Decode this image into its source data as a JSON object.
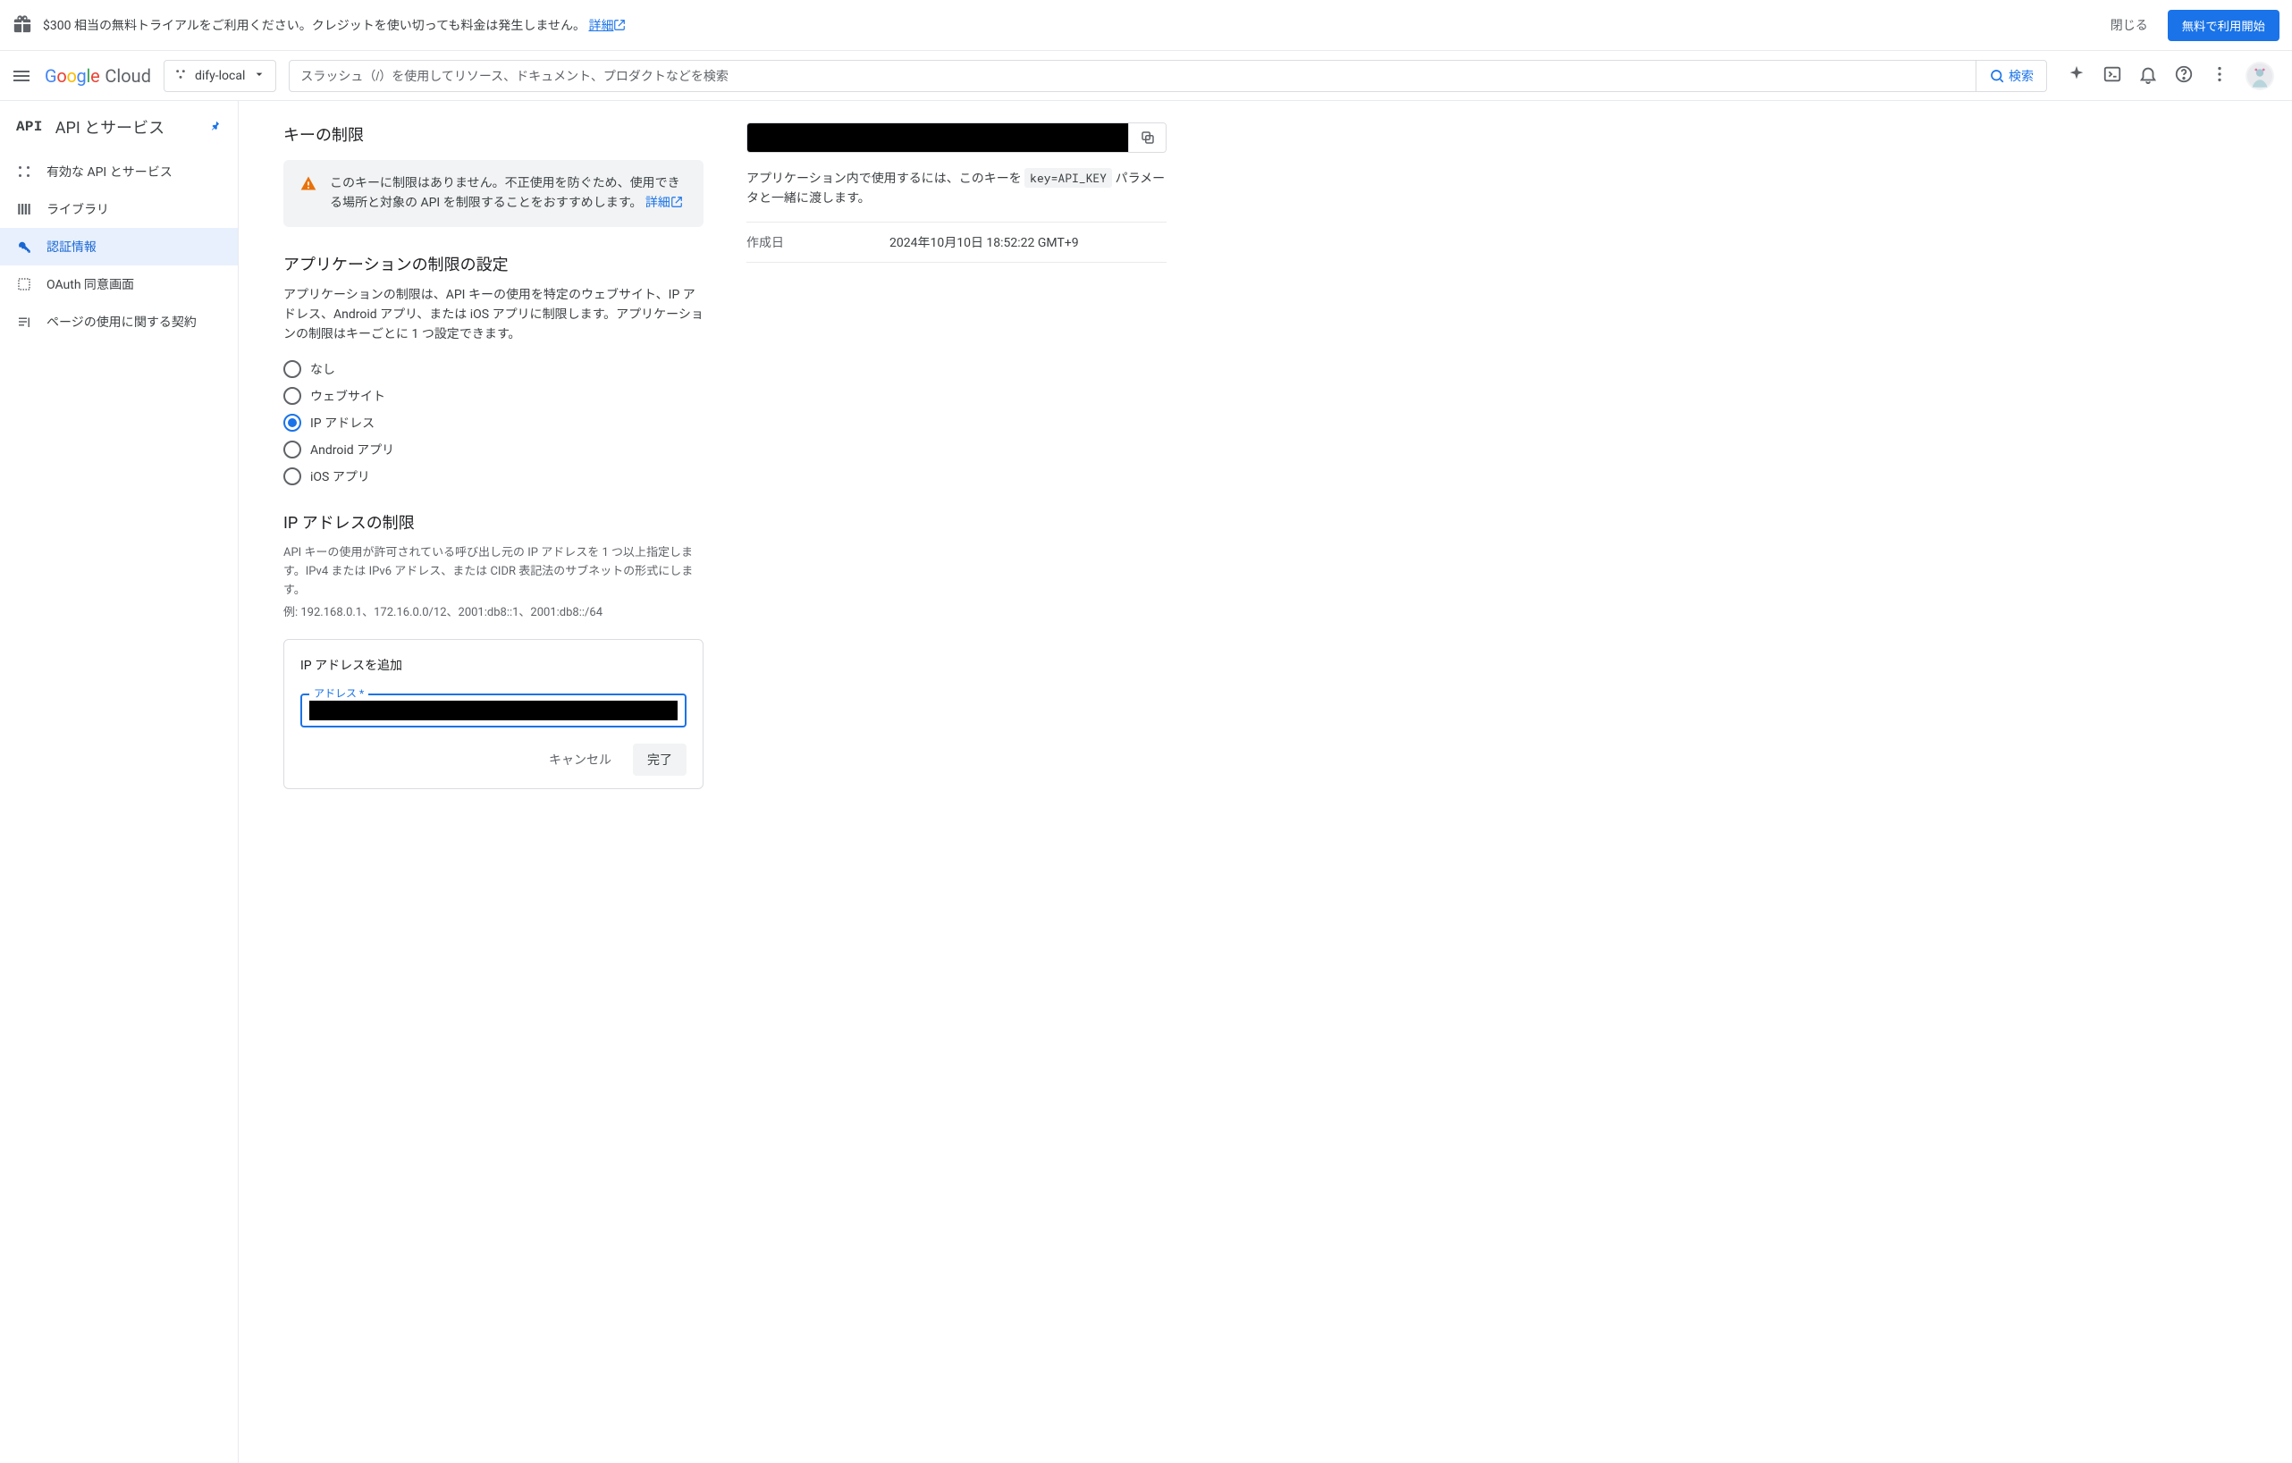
{
  "promo": {
    "text": "$300 相当の無料トライアルをご利用ください。クレジットを使い切っても料金は発生しません。",
    "link_label": "詳細",
    "dismiss_label": "閉じる",
    "cta_label": "無料で利用開始"
  },
  "header": {
    "logo_cloud": "Cloud",
    "project_name": "dify-local",
    "search_placeholder": "スラッシュ（/）を使用してリソース、ドキュメント、プロダクトなどを検索",
    "search_button": "検索"
  },
  "sidebar": {
    "section_title": "API とサービス",
    "items": [
      {
        "label": "有効な API とサービス"
      },
      {
        "label": "ライブラリ"
      },
      {
        "label": "認証情報"
      },
      {
        "label": "OAuth 同意画面"
      },
      {
        "label": "ページの使用に関する契約"
      }
    ]
  },
  "main": {
    "restriction_title": "キーの制限",
    "warning_text": "このキーに制限はありません。不正使用を防ぐため、使用できる場所と対象の API を制限することをおすすめします。",
    "warning_link": "詳細",
    "app_restriction_title": "アプリケーションの制限の設定",
    "app_restriction_body": "アプリケーションの制限は、API キーの使用を特定のウェブサイト、IP アドレス、Android アプリ、または iOS アプリに制限します。アプリケーションの制限はキーごとに 1 つ設定できます。",
    "radios": [
      {
        "label": "なし"
      },
      {
        "label": "ウェブサイト"
      },
      {
        "label": "IP アドレス"
      },
      {
        "label": "Android アプリ"
      },
      {
        "label": "iOS アプリ"
      }
    ],
    "ip_section_title": "IP アドレスの制限",
    "ip_hint1": "API キーの使用が許可されている呼び出し元の IP アドレスを 1 つ以上指定します。IPv4 または IPv6 アドレス、または CIDR 表記法のサブネットの形式にします。",
    "ip_hint2": "例: 192.168.0.1、172.16.0.0/12、2001:db8::1、2001:db8::/64",
    "ip_card_title": "IP アドレスを追加",
    "field_label": "アドレス *",
    "cancel_label": "キャンセル",
    "done_label": "完了"
  },
  "right": {
    "usage_text_pre": "アプリケーション内で使用するには、このキーを ",
    "usage_code": "key=API_KEY",
    "usage_text_post": " パラメータと一緒に渡します。",
    "created_label": "作成日",
    "created_value": "2024年10月10日 18:52:22 GMT+9"
  }
}
